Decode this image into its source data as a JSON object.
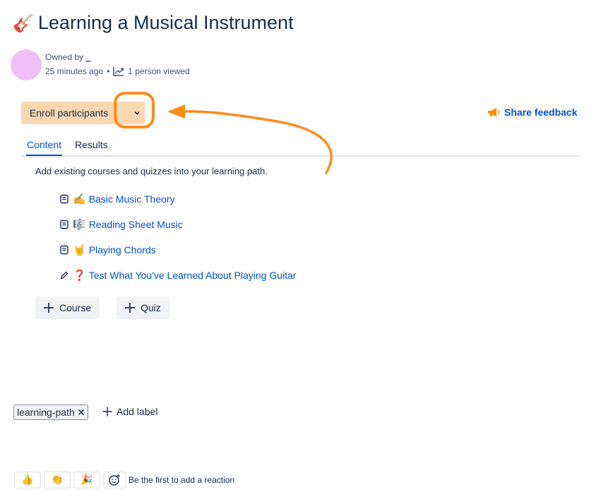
{
  "page": {
    "title_emoji": "🎸",
    "title": "Learning a Musical Instrument"
  },
  "owner": {
    "prefix": "Owned by",
    "name": "_",
    "time": "25 minutes ago",
    "separator": "•",
    "views": "1 person viewed"
  },
  "toolbar": {
    "enroll_label": "Enroll participants",
    "feedback_label": "Share feedback"
  },
  "tabs": [
    {
      "label": "Content",
      "active": true
    },
    {
      "label": "Results",
      "active": false
    }
  ],
  "content": {
    "description": "Add existing courses and quizzes into your learning path.",
    "items": [
      {
        "type": "course",
        "icon": "course-icon",
        "emoji": "✍️",
        "label": "Basic Music Theory"
      },
      {
        "type": "course",
        "icon": "course-icon",
        "emoji": "🎼",
        "label": "Reading Sheet Music"
      },
      {
        "type": "course",
        "icon": "course-icon",
        "emoji": "🤘",
        "label": "Playing Chords"
      },
      {
        "type": "quiz",
        "icon": "pencil-icon",
        "emoji": "❓",
        "label": "Test What You've Learned About Playing Guitar"
      }
    ],
    "add_course_label": "Course",
    "add_quiz_label": "Quiz"
  },
  "labels": {
    "items": [
      "learning-path"
    ],
    "add_label": "Add label"
  },
  "reactions": {
    "buttons": [
      {
        "icon": "thumbs-up-icon",
        "glyph": "👍"
      },
      {
        "icon": "clapping-hands-icon",
        "glyph": "👏"
      },
      {
        "icon": "party-popper-icon",
        "glyph": "🎉"
      }
    ],
    "message": "Be the first to add a reaction"
  },
  "colors": {
    "accent": "#0052cc",
    "enroll_bg": "#fdd7b0",
    "annotation": "#ff8c1a",
    "avatar": "#eec0f7"
  }
}
